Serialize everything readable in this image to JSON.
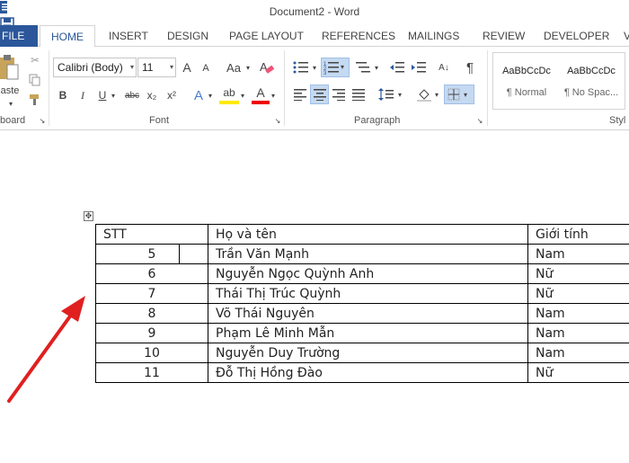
{
  "window": {
    "title": "Document2 - Word"
  },
  "tabs": [
    {
      "label": "FILE"
    },
    {
      "label": "HOME"
    },
    {
      "label": "INSERT"
    },
    {
      "label": "DESIGN"
    },
    {
      "label": "PAGE LAYOUT"
    },
    {
      "label": "REFERENCES"
    },
    {
      "label": "MAILINGS"
    },
    {
      "label": "REVIEW"
    },
    {
      "label": "DEVELOPER"
    },
    {
      "label": "V"
    }
  ],
  "ribbon": {
    "clipboard": {
      "label": "board",
      "paste_label": "aste"
    },
    "font": {
      "label": "Font",
      "name": "Calibri (Body)",
      "size": "11",
      "grow": "A",
      "shrink": "A",
      "case": "Aa",
      "bold": "B",
      "italic": "I",
      "underline": "U",
      "strike": "abc",
      "subscript": "x₂",
      "superscript": "x²",
      "effects": "A",
      "highlight": "ab",
      "color": "A"
    },
    "paragraph": {
      "label": "Paragraph",
      "sort": "A↓",
      "pilcrow": "¶"
    },
    "styles": {
      "label": "Styl",
      "items": [
        {
          "preview": "AaBbCcDc",
          "name": "¶ Normal"
        },
        {
          "preview": "AaBbCcDc",
          "name": "¶ No Spac..."
        }
      ]
    }
  },
  "table": {
    "header": [
      "STT",
      "Họ và tên",
      "Giới tính"
    ],
    "rows": [
      {
        "stt": "5",
        "name": "Trần Văn Mạnh",
        "gender": "Nam"
      },
      {
        "stt": "6",
        "name": "Nguyễn Ngọc Quỳnh Anh",
        "gender": "Nữ"
      },
      {
        "stt": "7",
        "name": "Thái Thị Trúc Quỳnh",
        "gender": "Nữ"
      },
      {
        "stt": "8",
        "name": "Võ Thái Nguyên",
        "gender": "Nam"
      },
      {
        "stt": "9",
        "name": "Phạm Lê Minh Mẫn",
        "gender": "Nam"
      },
      {
        "stt": "10",
        "name": "Nguyễn Duy Trường",
        "gender": "Nam"
      },
      {
        "stt": "11",
        "name": "Đỗ Thị Hồng Đào",
        "gender": "Nữ"
      }
    ]
  },
  "colors": {
    "accent": "#2b579a",
    "arrow": "#e02020"
  }
}
